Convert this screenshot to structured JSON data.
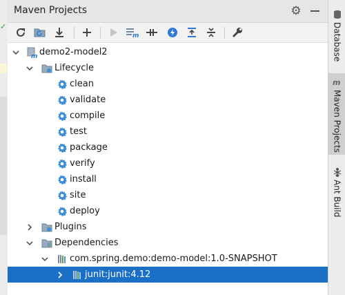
{
  "window": {
    "title": "Maven Projects"
  },
  "toolbar": {
    "icons": [
      "refresh-icon",
      "generate-sources-icon",
      "download-icon",
      "add-icon",
      "run-icon",
      "execute-goal-icon",
      "toggle-offline-icon",
      "lightning-icon",
      "collapse-all-icon",
      "expand-collapse-icon",
      "wrench-icon"
    ]
  },
  "tree": {
    "project": "demo2-model2",
    "lifecycle": {
      "label": "Lifecycle",
      "goals": [
        "clean",
        "validate",
        "compile",
        "test",
        "package",
        "verify",
        "install",
        "site",
        "deploy"
      ]
    },
    "plugins": "Plugins",
    "dependencies": {
      "label": "Dependencies",
      "items": [
        {
          "label": "com.spring.demo:demo-model:1.0-SNAPSHOT",
          "children": [
            {
              "label": "junit:junit:4.12",
              "selected": true
            }
          ]
        }
      ]
    }
  },
  "sidebar": {
    "tabs": [
      {
        "label": "Database"
      },
      {
        "label": "Maven Projects",
        "active": true
      },
      {
        "label": "Ant Build"
      }
    ]
  },
  "colors": {
    "selection": "#1c6fc7",
    "accent": "#2f7bd1",
    "gear": "#3d8fd8"
  }
}
